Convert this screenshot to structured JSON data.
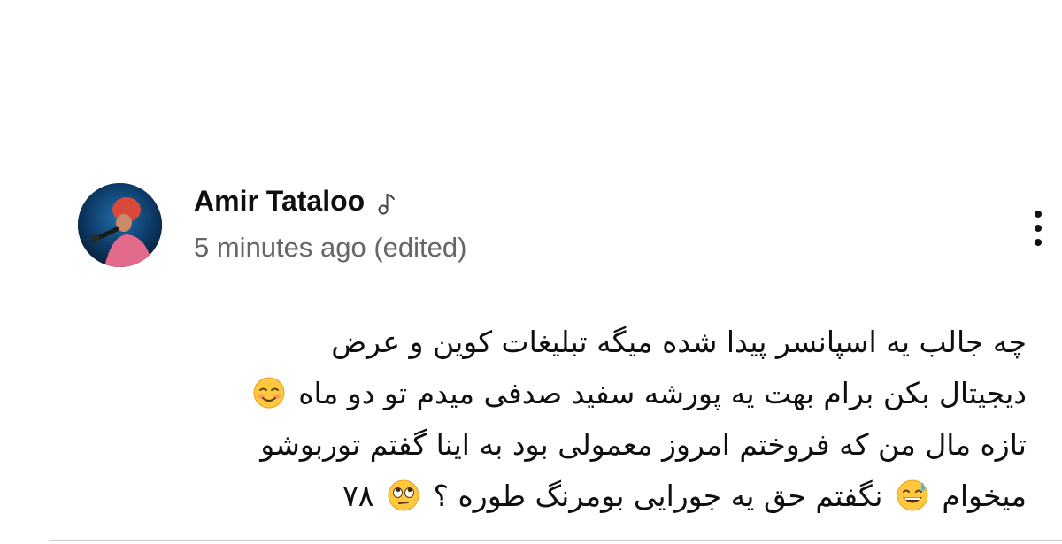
{
  "comment": {
    "author": "Amir Tataloo",
    "author_badge_icon": "music-note-icon",
    "timestamp": "5 minutes ago (edited)",
    "more_icon": "vertical-ellipsis-icon",
    "text_lines": [
      "چه جالب یه اسپانسر پیدا شده میگه تبلیغات کوین و عرض",
      "دیجیتال بکن برام بهت یه پورشه سفید صدفی میدم تو دو ماه",
      "تازه مال من که فروختم امروز معمولی بود به اینا گفتم توربوشو",
      "میخوام",
      "نگفتم حق یه جورایی بومرنگ طوره ؟",
      "۷۸"
    ],
    "emojis": [
      "smiling-blushing-emoji",
      "grinning-sweat-emoji",
      "eye-roll-emoji"
    ]
  },
  "colors": {
    "text": "#0f0f0f",
    "secondary_text": "#666666",
    "background": "#ffffff",
    "emoji_yellow": "#ffc83d"
  }
}
